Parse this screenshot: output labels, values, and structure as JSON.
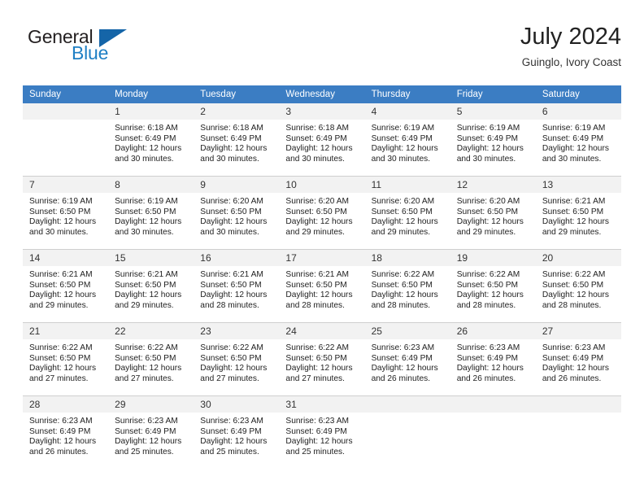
{
  "brand": {
    "name_top": "General",
    "name_bottom": "Blue",
    "color_dark": "#231f20",
    "color_blue": "#1f7fc4",
    "triangle_color": "#1565a8"
  },
  "header": {
    "title": "July 2024",
    "subtitle": "Guinglo, Ivory Coast"
  },
  "theme": {
    "header_band": "#3b7dc3",
    "daynum_band": "#f2f2f2",
    "row_divider": "#cfcfcf"
  },
  "weekdays": [
    "Sunday",
    "Monday",
    "Tuesday",
    "Wednesday",
    "Thursday",
    "Friday",
    "Saturday"
  ],
  "weeks": [
    [
      {
        "day": "",
        "lines": []
      },
      {
        "day": "1",
        "lines": [
          "Sunrise: 6:18 AM",
          "Sunset: 6:49 PM",
          "Daylight: 12 hours",
          "and 30 minutes."
        ]
      },
      {
        "day": "2",
        "lines": [
          "Sunrise: 6:18 AM",
          "Sunset: 6:49 PM",
          "Daylight: 12 hours",
          "and 30 minutes."
        ]
      },
      {
        "day": "3",
        "lines": [
          "Sunrise: 6:18 AM",
          "Sunset: 6:49 PM",
          "Daylight: 12 hours",
          "and 30 minutes."
        ]
      },
      {
        "day": "4",
        "lines": [
          "Sunrise: 6:19 AM",
          "Sunset: 6:49 PM",
          "Daylight: 12 hours",
          "and 30 minutes."
        ]
      },
      {
        "day": "5",
        "lines": [
          "Sunrise: 6:19 AM",
          "Sunset: 6:49 PM",
          "Daylight: 12 hours",
          "and 30 minutes."
        ]
      },
      {
        "day": "6",
        "lines": [
          "Sunrise: 6:19 AM",
          "Sunset: 6:49 PM",
          "Daylight: 12 hours",
          "and 30 minutes."
        ]
      }
    ],
    [
      {
        "day": "7",
        "lines": [
          "Sunrise: 6:19 AM",
          "Sunset: 6:50 PM",
          "Daylight: 12 hours",
          "and 30 minutes."
        ]
      },
      {
        "day": "8",
        "lines": [
          "Sunrise: 6:19 AM",
          "Sunset: 6:50 PM",
          "Daylight: 12 hours",
          "and 30 minutes."
        ]
      },
      {
        "day": "9",
        "lines": [
          "Sunrise: 6:20 AM",
          "Sunset: 6:50 PM",
          "Daylight: 12 hours",
          "and 30 minutes."
        ]
      },
      {
        "day": "10",
        "lines": [
          "Sunrise: 6:20 AM",
          "Sunset: 6:50 PM",
          "Daylight: 12 hours",
          "and 29 minutes."
        ]
      },
      {
        "day": "11",
        "lines": [
          "Sunrise: 6:20 AM",
          "Sunset: 6:50 PM",
          "Daylight: 12 hours",
          "and 29 minutes."
        ]
      },
      {
        "day": "12",
        "lines": [
          "Sunrise: 6:20 AM",
          "Sunset: 6:50 PM",
          "Daylight: 12 hours",
          "and 29 minutes."
        ]
      },
      {
        "day": "13",
        "lines": [
          "Sunrise: 6:21 AM",
          "Sunset: 6:50 PM",
          "Daylight: 12 hours",
          "and 29 minutes."
        ]
      }
    ],
    [
      {
        "day": "14",
        "lines": [
          "Sunrise: 6:21 AM",
          "Sunset: 6:50 PM",
          "Daylight: 12 hours",
          "and 29 minutes."
        ]
      },
      {
        "day": "15",
        "lines": [
          "Sunrise: 6:21 AM",
          "Sunset: 6:50 PM",
          "Daylight: 12 hours",
          "and 29 minutes."
        ]
      },
      {
        "day": "16",
        "lines": [
          "Sunrise: 6:21 AM",
          "Sunset: 6:50 PM",
          "Daylight: 12 hours",
          "and 28 minutes."
        ]
      },
      {
        "day": "17",
        "lines": [
          "Sunrise: 6:21 AM",
          "Sunset: 6:50 PM",
          "Daylight: 12 hours",
          "and 28 minutes."
        ]
      },
      {
        "day": "18",
        "lines": [
          "Sunrise: 6:22 AM",
          "Sunset: 6:50 PM",
          "Daylight: 12 hours",
          "and 28 minutes."
        ]
      },
      {
        "day": "19",
        "lines": [
          "Sunrise: 6:22 AM",
          "Sunset: 6:50 PM",
          "Daylight: 12 hours",
          "and 28 minutes."
        ]
      },
      {
        "day": "20",
        "lines": [
          "Sunrise: 6:22 AM",
          "Sunset: 6:50 PM",
          "Daylight: 12 hours",
          "and 28 minutes."
        ]
      }
    ],
    [
      {
        "day": "21",
        "lines": [
          "Sunrise: 6:22 AM",
          "Sunset: 6:50 PM",
          "Daylight: 12 hours",
          "and 27 minutes."
        ]
      },
      {
        "day": "22",
        "lines": [
          "Sunrise: 6:22 AM",
          "Sunset: 6:50 PM",
          "Daylight: 12 hours",
          "and 27 minutes."
        ]
      },
      {
        "day": "23",
        "lines": [
          "Sunrise: 6:22 AM",
          "Sunset: 6:50 PM",
          "Daylight: 12 hours",
          "and 27 minutes."
        ]
      },
      {
        "day": "24",
        "lines": [
          "Sunrise: 6:22 AM",
          "Sunset: 6:50 PM",
          "Daylight: 12 hours",
          "and 27 minutes."
        ]
      },
      {
        "day": "25",
        "lines": [
          "Sunrise: 6:23 AM",
          "Sunset: 6:49 PM",
          "Daylight: 12 hours",
          "and 26 minutes."
        ]
      },
      {
        "day": "26",
        "lines": [
          "Sunrise: 6:23 AM",
          "Sunset: 6:49 PM",
          "Daylight: 12 hours",
          "and 26 minutes."
        ]
      },
      {
        "day": "27",
        "lines": [
          "Sunrise: 6:23 AM",
          "Sunset: 6:49 PM",
          "Daylight: 12 hours",
          "and 26 minutes."
        ]
      }
    ],
    [
      {
        "day": "28",
        "lines": [
          "Sunrise: 6:23 AM",
          "Sunset: 6:49 PM",
          "Daylight: 12 hours",
          "and 26 minutes."
        ]
      },
      {
        "day": "29",
        "lines": [
          "Sunrise: 6:23 AM",
          "Sunset: 6:49 PM",
          "Daylight: 12 hours",
          "and 25 minutes."
        ]
      },
      {
        "day": "30",
        "lines": [
          "Sunrise: 6:23 AM",
          "Sunset: 6:49 PM",
          "Daylight: 12 hours",
          "and 25 minutes."
        ]
      },
      {
        "day": "31",
        "lines": [
          "Sunrise: 6:23 AM",
          "Sunset: 6:49 PM",
          "Daylight: 12 hours",
          "and 25 minutes."
        ]
      },
      {
        "day": "",
        "lines": []
      },
      {
        "day": "",
        "lines": []
      },
      {
        "day": "",
        "lines": []
      }
    ]
  ]
}
